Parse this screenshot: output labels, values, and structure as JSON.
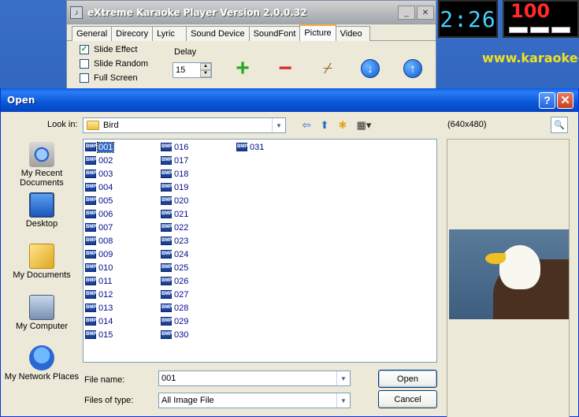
{
  "bg_app": {
    "title": "eXtreme Karaoke Player Version 2.0.0.32",
    "tabs": [
      "General",
      "Direcory",
      "Lyric",
      "Sound Device",
      "SoundFont",
      "Picture",
      "Video"
    ],
    "active_tab": "Picture",
    "checkboxes": [
      {
        "label": "Slide Effect",
        "checked": true
      },
      {
        "label": "Slide Random",
        "checked": false
      },
      {
        "label": "Full Screen",
        "checked": false
      }
    ],
    "delay_label": "Delay",
    "delay_value": "15",
    "clock": "2:26",
    "score": "100",
    "site": "www.karaoke-s"
  },
  "dialog": {
    "title": "Open",
    "look_in_label": "Look in:",
    "look_in_value": "Bird",
    "preview_size": "(640x480)",
    "places": [
      {
        "label": "My Recent Documents",
        "icon": "recent-documents-icon"
      },
      {
        "label": "Desktop",
        "icon": "desktop-icon"
      },
      {
        "label": "My Documents",
        "icon": "my-documents-icon"
      },
      {
        "label": "My Computer",
        "icon": "my-computer-icon"
      },
      {
        "label": "My Network Places",
        "icon": "network-places-icon"
      }
    ],
    "files": [
      "001",
      "002",
      "003",
      "004",
      "005",
      "006",
      "007",
      "008",
      "009",
      "010",
      "011",
      "012",
      "013",
      "014",
      "015",
      "016",
      "017",
      "018",
      "019",
      "020",
      "021",
      "022",
      "023",
      "024",
      "025",
      "026",
      "027",
      "028",
      "029",
      "030",
      "031"
    ],
    "file_icon_text": "BMP",
    "selected_file": "001",
    "file_name_label": "File name:",
    "file_name_value": "001",
    "files_of_type_label": "Files of type:",
    "files_of_type_value": "All Image File",
    "open_label": "Open",
    "cancel_label": "Cancel"
  }
}
